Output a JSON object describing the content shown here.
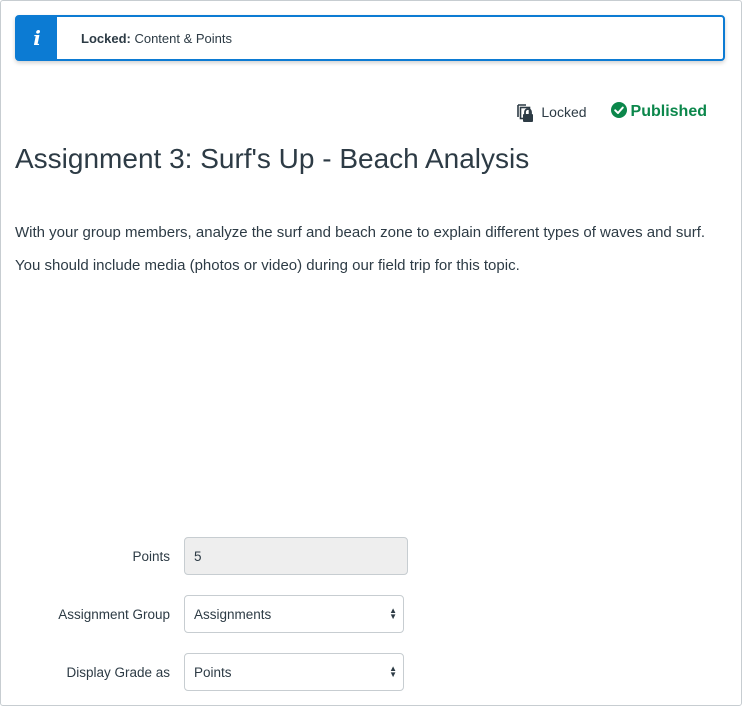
{
  "alert": {
    "icon": "info-icon",
    "icon_glyph": "i",
    "label_bold": "Locked:",
    "label_text": " Content & Points"
  },
  "status": {
    "locked_icon": "locked-copy-icon",
    "locked_label": "Locked",
    "published_icon": "check-circle-icon",
    "published_label": "Published",
    "published_color": "#0b874b"
  },
  "assignment": {
    "title": "Assignment 3: Surf's Up - Beach Analysis",
    "description": [
      "With your group members, analyze the surf and beach zone to explain different types of waves and surf.",
      "You should include media (photos or video) during our field trip for this topic."
    ]
  },
  "form": {
    "points": {
      "label": "Points",
      "value": "5"
    },
    "assignment_group": {
      "label": "Assignment Group",
      "selected": "Assignments"
    },
    "display_grade": {
      "label": "Display Grade as",
      "selected": "Points"
    }
  },
  "colors": {
    "accent": "#0c7bd3",
    "text": "#2d3b45"
  }
}
